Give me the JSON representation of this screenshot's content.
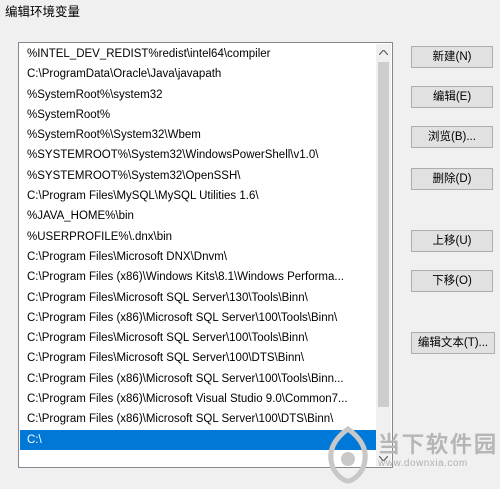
{
  "window": {
    "title": "编辑环境变量"
  },
  "path_list": {
    "items": [
      "%INTEL_DEV_REDIST%redist\\intel64\\compiler",
      "C:\\ProgramData\\Oracle\\Java\\javapath",
      "%SystemRoot%\\system32",
      "%SystemRoot%",
      "%SystemRoot%\\System32\\Wbem",
      "%SYSTEMROOT%\\System32\\WindowsPowerShell\\v1.0\\",
      "%SYSTEMROOT%\\System32\\OpenSSH\\",
      "C:\\Program Files\\MySQL\\MySQL Utilities 1.6\\",
      "%JAVA_HOME%\\bin",
      "%USERPROFILE%\\.dnx\\bin",
      "C:\\Program Files\\Microsoft DNX\\Dnvm\\",
      "C:\\Program Files (x86)\\Windows Kits\\8.1\\Windows Performa...",
      "C:\\Program Files\\Microsoft SQL Server\\130\\Tools\\Binn\\",
      "C:\\Program Files (x86)\\Microsoft SQL Server\\100\\Tools\\Binn\\",
      "C:\\Program Files\\Microsoft SQL Server\\100\\Tools\\Binn\\",
      "C:\\Program Files\\Microsoft SQL Server\\100\\DTS\\Binn\\",
      "C:\\Program Files (x86)\\Microsoft SQL Server\\100\\Tools\\Binn...",
      "C:\\Program Files (x86)\\Microsoft Visual Studio 9.0\\Common7...",
      "C:\\Program Files (x86)\\Microsoft SQL Server\\100\\DTS\\Binn\\",
      "C:\\"
    ],
    "selected_index": 19
  },
  "buttons": {
    "new": "新建(N)",
    "edit": "编辑(E)",
    "browse": "浏览(B)...",
    "delete": "删除(D)",
    "move_up": "上移(U)",
    "move_down": "下移(O)",
    "edit_text": "编辑文本(T)..."
  },
  "watermark": {
    "brand": "当下软件园",
    "url": "www.downxia.com"
  }
}
